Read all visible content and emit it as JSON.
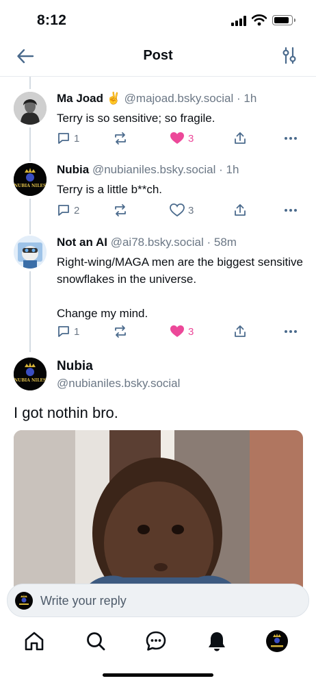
{
  "status_bar": {
    "time": "8:12"
  },
  "header": {
    "title": "Post"
  },
  "replies": [
    {
      "name": "Ma Joad ✌️",
      "handle": "@majoad.bsky.social",
      "time": "1h",
      "text": "Terry is so sensitive; so fragile.",
      "reply_count": "1",
      "like_count": "3",
      "liked": true
    },
    {
      "name": "Nubia",
      "handle": "@nubianiles.bsky.social",
      "time": "1h",
      "text": "Terry is a little b**ch.",
      "reply_count": "2",
      "like_count": "3",
      "liked": false
    },
    {
      "name": "Not an AI",
      "handle": "@ai78.bsky.social",
      "time": "58m",
      "text": "Right-wing/MAGA men are the biggest sensitive snowflakes in the universe.\n\nChange my mind.",
      "reply_count": "1",
      "like_count": "3",
      "liked": true
    }
  ],
  "main_post": {
    "name": "Nubia",
    "handle": "@nubianiles.bsky.social",
    "text": "I got nothin bro.",
    "avatar_label": "NUBIA NILES"
  },
  "reply_bar": {
    "placeholder": "Write your reply"
  },
  "colors": {
    "like": "#ec4899",
    "accent": "#1083fe",
    "muted": "#6b7785"
  },
  "tabs": [
    "home-icon",
    "search-icon",
    "chat-icon",
    "bell-icon",
    "profile-avatar"
  ]
}
